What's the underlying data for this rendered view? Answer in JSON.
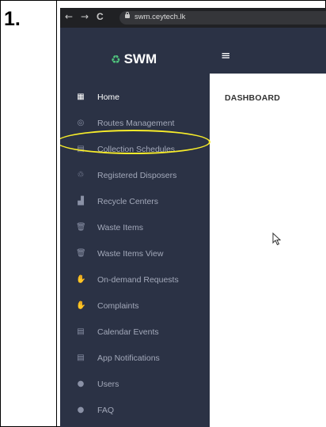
{
  "step": {
    "number": "1."
  },
  "browser": {
    "url": "swm.ceytech.lk",
    "back_glyph": "←",
    "forward_glyph": "→",
    "reload_glyph": "C"
  },
  "app": {
    "logo_text": "SWM",
    "logo_glyph": "♻"
  },
  "header": {
    "menu_glyph": "≡"
  },
  "sidebar": {
    "highlighted_item": "Collection Schedules",
    "highlight_color": "#f7ec2a",
    "items": [
      {
        "label": "Home",
        "icon": "dashboard-icon",
        "glyph": "▦",
        "active": true
      },
      {
        "label": "Routes Management",
        "icon": "location-pin-icon",
        "glyph": "◎"
      },
      {
        "label": "Collection Schedules",
        "icon": "calendar-icon",
        "glyph": "▤"
      },
      {
        "label": "Registered Disposers",
        "icon": "recycle-icon",
        "glyph": "♲"
      },
      {
        "label": "Recycle Centers",
        "icon": "industry-icon",
        "glyph": "▟"
      },
      {
        "label": "Waste Items",
        "icon": "trash-icon",
        "glyph": "🗑"
      },
      {
        "label": "Waste Items View",
        "icon": "trash-icon",
        "glyph": "🗑"
      },
      {
        "label": "On-demand Requests",
        "icon": "hand-icon",
        "glyph": "✋"
      },
      {
        "label": "Complaints",
        "icon": "hand-icon",
        "glyph": "✋"
      },
      {
        "label": "Calendar Events",
        "icon": "calendar-icon",
        "glyph": "▤"
      },
      {
        "label": "App Notifications",
        "icon": "calendar-icon",
        "glyph": "▤"
      },
      {
        "label": "Users",
        "icon": "user-icon",
        "glyph": "●"
      },
      {
        "label": "FAQ",
        "icon": "user-icon",
        "glyph": "●"
      }
    ]
  },
  "main": {
    "title": "DASHBOARD"
  }
}
